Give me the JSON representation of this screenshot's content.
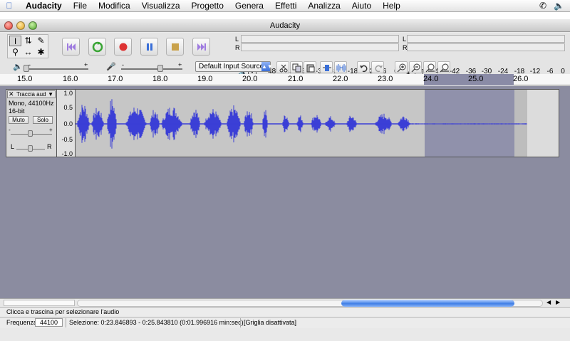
{
  "menubar": {
    "app": "Audacity",
    "items": [
      "File",
      "Modifica",
      "Visualizza",
      "Progetto",
      "Genera",
      "Effetti",
      "Analizza",
      "Aiuto",
      "Help"
    ]
  },
  "window": {
    "title": "Audacity"
  },
  "meters": {
    "play_l": "L",
    "play_r": "R",
    "rec_l": "L",
    "rec_r": "R",
    "ticks": [
      "-48",
      "-42",
      "-36",
      "-30",
      "-24",
      "-18",
      "-12",
      "-6",
      "0"
    ]
  },
  "edit": {
    "input_source": "Default Input Source",
    "gain_minus": "-",
    "gain_plus": "+",
    "vol_minus": "-",
    "vol_plus": "+"
  },
  "ruler": {
    "ticks": [
      "15.0",
      "16.0",
      "17.0",
      "18.0",
      "19.0",
      "20.0",
      "21.0",
      "22.0",
      "23.0",
      "24.0",
      "25.0",
      "26.0"
    ]
  },
  "track": {
    "name": "Traccia aud",
    "format": "Mono, 44100Hz",
    "bit_depth": "16-bit",
    "mute_label": "Muto",
    "solo_label": "Solo",
    "gain_minus": "-",
    "gain_plus": "+",
    "pan_left": "L",
    "pan_right": "R",
    "scale": [
      "1.0",
      "0.5",
      "0.0",
      "-0.5",
      "-1.0"
    ]
  },
  "status": {
    "hint": "Clicca e trascina per selezionare l'audio",
    "rate_label": "Frequenza:",
    "rate_value": "44100",
    "selection": "Selezione: 0:23.846893 - 0:25.843810 (0:01.996916 min:sec)",
    "grid": "[Griglia disattivata]"
  },
  "colors": {
    "waveform": "#3b3fd6",
    "selection": "#9091ab",
    "background": "#8b8ca0"
  }
}
